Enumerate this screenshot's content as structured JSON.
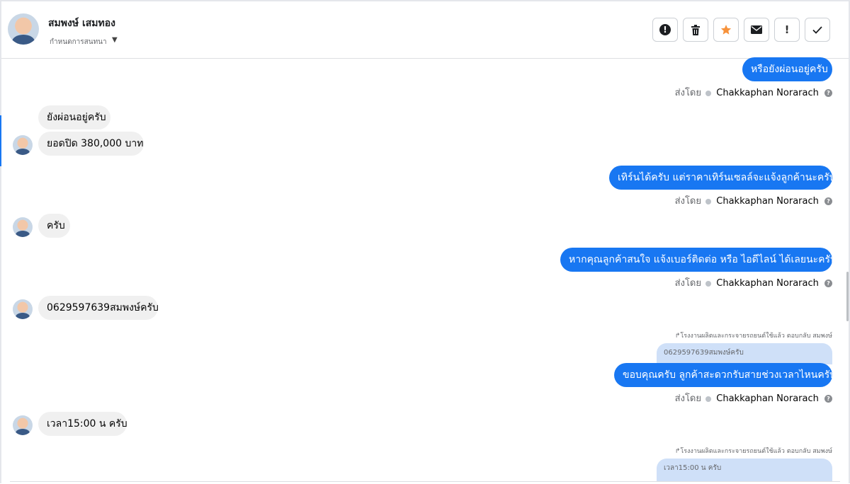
{
  "header": {
    "contact_name": "สมพงษ์ เสมทอง",
    "assign_label": "กำหนดการสนทนา",
    "actions": [
      {
        "name": "spam-button",
        "icon": "exclamation-circle-icon"
      },
      {
        "name": "delete-button",
        "icon": "trash-icon"
      },
      {
        "name": "star-button",
        "icon": "star-icon",
        "color": "#f7923b"
      },
      {
        "name": "mark-unread-button",
        "icon": "envelope-icon"
      },
      {
        "name": "follow-up-button",
        "icon": "exclamation-icon"
      },
      {
        "name": "mark-done-button",
        "icon": "checkmark-icon"
      }
    ]
  },
  "messages": {
    "m1": {
      "text": "หรือยังผ่อนอยู่ครับ"
    },
    "s1": {
      "label": "ส่งโดย",
      "name": "Chakkaphan Norarach"
    },
    "m2": {
      "text": "ยังผ่อนอยู่ครับ"
    },
    "m3": {
      "text": "ยอดปิด 380,000 บาท"
    },
    "m4": {
      "text": "เทิร์นได้ครับ แต่ราคาเทิร์นเซลล์จะแจ้งลูกค้านะครับ"
    },
    "s2": {
      "label": "ส่งโดย",
      "name": "Chakkaphan Norarach"
    },
    "m5": {
      "text": "ครับ"
    },
    "m6": {
      "text": "หากคุณลูกค้าสนใจ แจ้งเบอร์ติดต่อ หรือ ไอดีไลน์ ได้เลยนะครับ"
    },
    "s3": {
      "label": "ส่งโดย",
      "name": "Chakkaphan Norarach"
    },
    "m7": {
      "text": "0629597639สมพงษ์ครับ"
    },
    "r1": {
      "note": "โรงงานผลิตและกระจายรถยนต์ใช้แล้ว ตอบกลับ สมพงษ์",
      "quoted": "0629597639สมพงษ์ครับ"
    },
    "m8": {
      "text": "ขอบคุณครับ ลูกค้าสะดวกรับสายช่วงเวลาไหนครับ"
    },
    "s4": {
      "label": "ส่งโดย",
      "name": "Chakkaphan Norarach"
    },
    "m9": {
      "text": "เวลา15:00 น ครับ"
    },
    "r2": {
      "note": "โรงงานผลิตและกระจายรถยนต์ใช้แล้ว ตอบกลับ สมพงษ์",
      "quoted": "เวลา15:00 น ครับ"
    }
  },
  "colors": {
    "accent": "#1877f2",
    "incoming": "#f0f0f0",
    "star": "#f7923b"
  }
}
